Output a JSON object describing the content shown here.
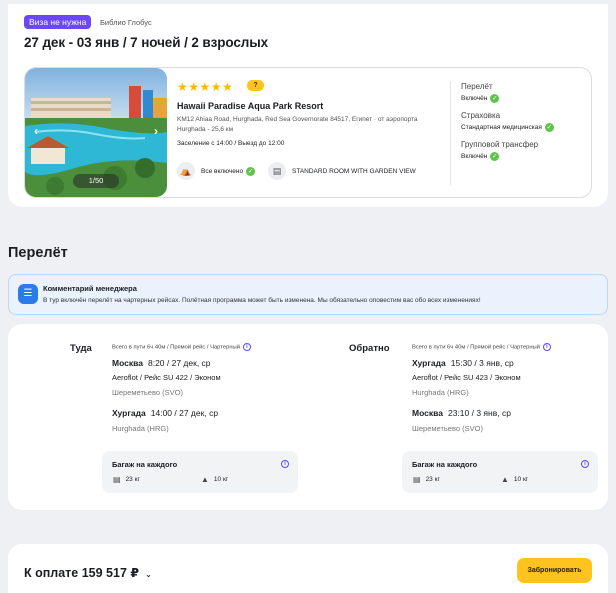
{
  "offer": {
    "visa_badge": "Виза не нужна",
    "operator": "Библио Глобус",
    "trip_title": "27 дек - 03 янв / 7 ночей / 2 взрослых"
  },
  "hotel": {
    "stars": "★★★★★",
    "rating": "?",
    "name": "Hawaii Paradise Aqua Park Resort",
    "address": "KM12 Ahiaa Road, Hurghada, Red Sea Governorate 84517, Египет · от аэропорта Hurghada - 25,6 км",
    "checkin": "Заселение с 14:00 / Выезд до 12:00",
    "meal": "Все включено",
    "room": "STANDARD ROOM WITH GARDEN VIEW",
    "photo_counter": "1/50",
    "photo_prev": "‹",
    "photo_next": "›"
  },
  "services": {
    "flight_label": "Перелёт",
    "flight_value": "Включён",
    "insurance_label": "Страховка",
    "insurance_value": "Стандартная медицинская",
    "transfer_label": "Групповой трансфер",
    "transfer_value": "Включён"
  },
  "section_title": "Перелёт",
  "manager_comment": {
    "title": "Комментарий менеджера",
    "text": "В тур включён перелёт на чартерных рейсах. Полётная программа может быть изменена. Мы обязательно оповестим вас обо всех изменениях!"
  },
  "outbound": {
    "label": "Туда",
    "meta": "Всего в пути 6ч 40м / Прямой рейс / Чартерный",
    "from_city": "Москва",
    "from_time": "8:20 / 27 дек, ср",
    "flight": "Aeroflot / Рейс SU 422 / Эконом",
    "from_airport": "Шереметьево (SVO)",
    "to_city": "Хургада",
    "to_time": "14:00 / 27 дек, ср",
    "to_airport": "Hurghada (HRG)",
    "baggage_title": "Багаж на каждого",
    "baggage_checked": "23 кг",
    "baggage_cabin": "10 кг"
  },
  "return": {
    "label": "Обратно",
    "meta": "Всего в пути 6ч 40м / Прямой рейс / Чартерный",
    "from_city": "Хургада",
    "from_time": "15:30 / 3 янв, ср",
    "flight": "Aeroflot / Рейс SU 423 / Эконом",
    "from_airport": "Hurghada (HRG)",
    "to_city": "Москва",
    "to_time": "23:10 / 3 янв, ср",
    "to_airport": "Шереметьево (SVO)",
    "baggage_title": "Багаж на каждого",
    "baggage_checked": "23 кг",
    "baggage_cabin": "10 кг"
  },
  "footer": {
    "total": "К оплате 159 517 ₽",
    "book_button": "Забронировать"
  },
  "colors": {
    "accent_purple": "#6b47f6",
    "button_yellow": "#ffc31f",
    "check_green": "#5fc44a",
    "info_blue": "#2b7bea"
  }
}
